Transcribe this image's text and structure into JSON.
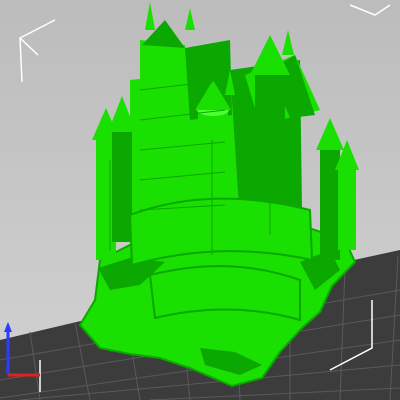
{
  "viewer": {
    "model_name": "castle-model",
    "colors": {
      "background_top": "#bcbcbc",
      "background_bottom": "#d2d2d2",
      "model": "#19e000",
      "model_shadow": "#0aa800",
      "model_highlight": "#4cff2e",
      "bed": "#3c3c3c",
      "grid": "#5a5a5a",
      "bounding_box": "#ffffff",
      "axis_x": "#e02020",
      "axis_z": "#2a3cff"
    },
    "icons": [
      "bounding-box-corner-icon",
      "axis-gizmo-icon"
    ]
  }
}
